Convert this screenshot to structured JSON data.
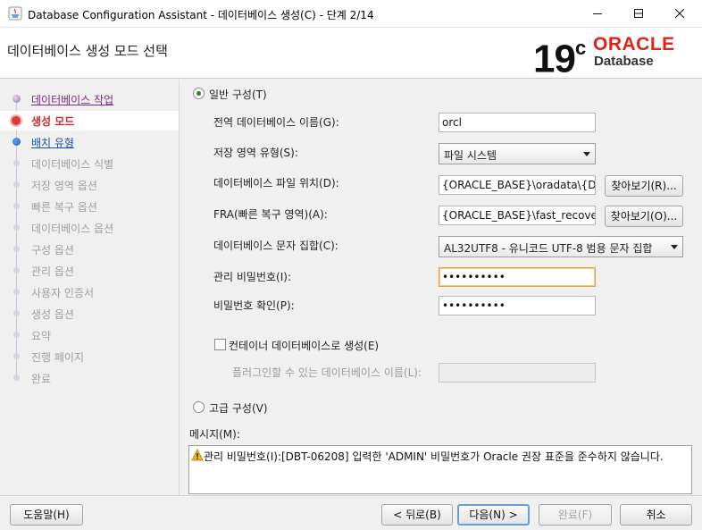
{
  "window": {
    "title": "Database Configuration Assistant - 데이터베이스 생성(C) - 단계 2/14"
  },
  "header": {
    "page_title": "데이터베이스 생성 모드 선택",
    "logo_version": "19",
    "logo_version_suffix": "c",
    "logo_brand": "ORACLE",
    "logo_product": "Database"
  },
  "sidebar": {
    "steps": [
      {
        "label": "데이터베이스 작업",
        "state": "done"
      },
      {
        "label": "생성 모드",
        "state": "current"
      },
      {
        "label": "배치 유형",
        "state": "next"
      },
      {
        "label": "데이터베이스 식별",
        "state": "pending"
      },
      {
        "label": "저장 영역 옵션",
        "state": "pending"
      },
      {
        "label": "빠른 복구 옵션",
        "state": "pending"
      },
      {
        "label": "데이터베이스 옵션",
        "state": "pending"
      },
      {
        "label": "구성 옵션",
        "state": "pending"
      },
      {
        "label": "관리 옵션",
        "state": "pending"
      },
      {
        "label": "사용자 인증서",
        "state": "pending"
      },
      {
        "label": "생성 옵션",
        "state": "pending"
      },
      {
        "label": "요약",
        "state": "pending"
      },
      {
        "label": "진행 페이지",
        "state": "pending"
      },
      {
        "label": "완료",
        "state": "pending"
      }
    ]
  },
  "form": {
    "typical_config": {
      "label": "일반 구성(T)",
      "selected": true
    },
    "global_db_name": {
      "label": "전역 데이터베이스 이름(G):",
      "value": "orcl"
    },
    "storage_type": {
      "label": "저장 영역 유형(S):",
      "value": "파일 시스템"
    },
    "db_file_location": {
      "label": "데이터베이스 파일 위치(D):",
      "value": "{ORACLE_BASE}\\oradata\\{DB_",
      "browse_label": "찾아보기(R)..."
    },
    "fra": {
      "label": "FRA(빠른 복구 영역)(A):",
      "value": "{ORACLE_BASE}\\fast_recovery_",
      "browse_label": "찾아보기(O)..."
    },
    "charset": {
      "label": "데이터베이스 문자 집합(C):",
      "value": "AL32UTF8 - 유니코드 UTF-8 범용 문자 집합"
    },
    "admin_password": {
      "label": "관리 비밀번호(I):",
      "value": "••••••••••"
    },
    "confirm_password": {
      "label": "비밀번호 확인(P):",
      "value": "••••••••••"
    },
    "container_db": {
      "label": "컨테이너 데이터베이스로 생성(E)",
      "checked": false
    },
    "pdb_name": {
      "label": "플러그인할 수 있는 데이터베이스 이름(L):",
      "value": ""
    },
    "advanced_config": {
      "label": "고급 구성(V)",
      "selected": false
    }
  },
  "messages": {
    "label": "메시지(M):",
    "text": "관리 비밀번호(I):[DBT-06208] 입력한 'ADMIN' 비밀번호가 Oracle 권장 표준을 준수하지 않습니다.",
    "level": "warning"
  },
  "footer": {
    "help": "도움말(H)",
    "back": "< 뒤로(B)",
    "next": "다음(N) >",
    "finish": "완료(F)",
    "cancel": "취소"
  },
  "colors": {
    "oracle_red": "#e2231a",
    "current_step": "#d0272d",
    "done_step": "#7a2a86",
    "next_step": "#1a4fa8",
    "focus_border": "#e8a33d"
  }
}
